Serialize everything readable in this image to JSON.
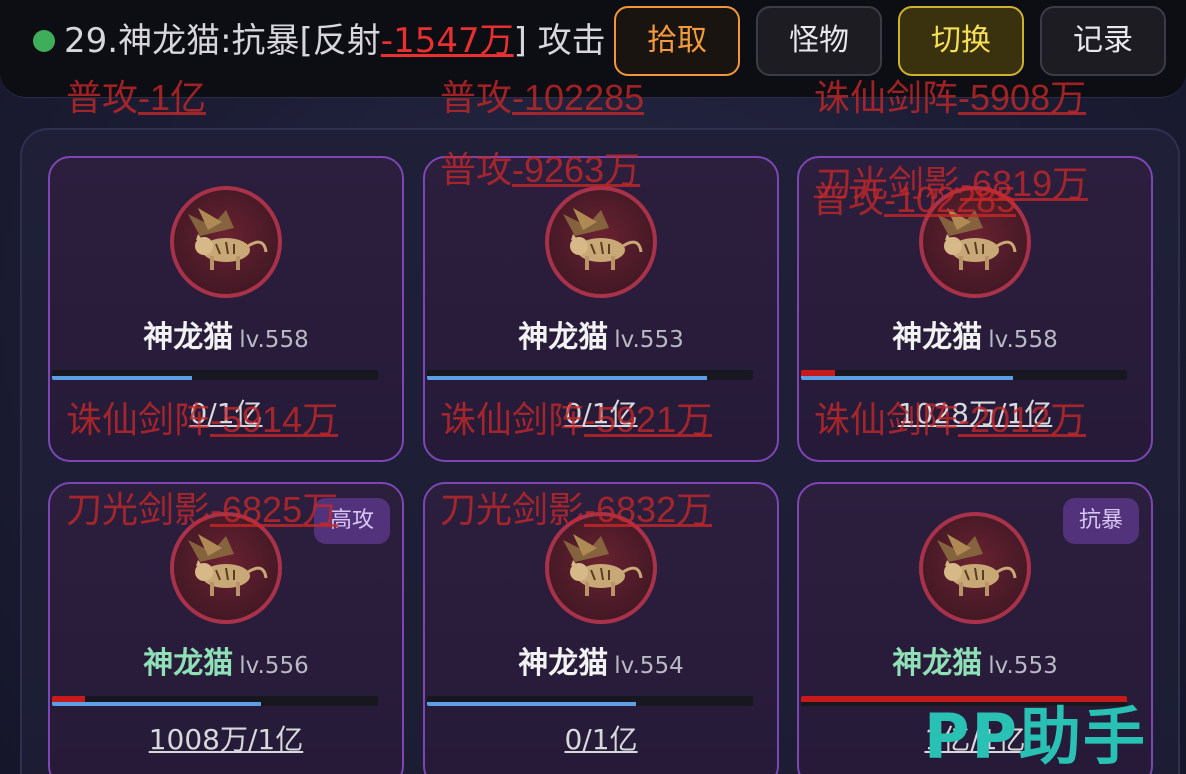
{
  "log": {
    "prefix": "29.神龙猫:抗暴[反射",
    "value": "-1547万",
    "suffix": "] 攻击"
  },
  "buttons": {
    "pickup": "拾取",
    "monster": "怪物",
    "switch": "切换",
    "record": "记录"
  },
  "monsters": [
    {
      "name": "神龙猫",
      "level": "lv.558",
      "hp": "0/1亿",
      "hp_fraction": 0.0,
      "progress_fraction": 0.43,
      "badge": "",
      "rare": false
    },
    {
      "name": "神龙猫",
      "level": "lv.553",
      "hp": "0/1亿",
      "hp_fraction": 0.0,
      "progress_fraction": 0.86,
      "badge": "",
      "rare": false
    },
    {
      "name": "神龙猫",
      "level": "lv.558",
      "hp": "1028万/1亿",
      "hp_fraction": 0.1028,
      "progress_fraction": 0.65,
      "badge": "",
      "rare": false
    },
    {
      "name": "神龙猫",
      "level": "lv.556",
      "hp": "1008万/1亿",
      "hp_fraction": 0.1008,
      "progress_fraction": 0.64,
      "badge": "高攻",
      "rare": true
    },
    {
      "name": "神龙猫",
      "level": "lv.554",
      "hp": "0/1亿",
      "hp_fraction": 0.0,
      "progress_fraction": 0.64,
      "badge": "",
      "rare": false
    },
    {
      "name": "神龙猫",
      "level": "lv.553",
      "hp": "1亿/1亿",
      "hp_fraction": 1.0,
      "progress_fraction": 0.0,
      "badge": "抗暴",
      "rare": true
    }
  ],
  "damage_texts": [
    {
      "label": "普攻",
      "value": "-1亿"
    },
    {
      "label": "普攻",
      "value": "-102285"
    },
    {
      "label": "诛仙剑阵",
      "value": "-5908万"
    },
    {
      "label": "普攻",
      "value": "-9263万"
    },
    {
      "label": "刀光剑影",
      "value": "-6819万"
    },
    {
      "label": "普攻",
      "value": "-102285"
    },
    {
      "label": "诛仙剑阵",
      "value": "-5914万"
    },
    {
      "label": "诛仙剑阵",
      "value": "-5921万"
    },
    {
      "label": "诛仙剑阵",
      "value": "-2012万"
    },
    {
      "label": "刀光剑影",
      "value": "-6825万"
    },
    {
      "label": "刀光剑影",
      "value": "-6832万"
    }
  ],
  "watermark": "PP助手",
  "colors": {
    "accent_orange": "#f39a3d",
    "accent_gold": "#f6df58",
    "card_border": "#7e45b4",
    "damage_red": "#c82828",
    "hp_blue": "#5d9fe6",
    "watermark_teal": "#29c1b4"
  },
  "icons": {
    "status": "online-dot-icon",
    "monster_portrait": "winged-cat-icon"
  }
}
